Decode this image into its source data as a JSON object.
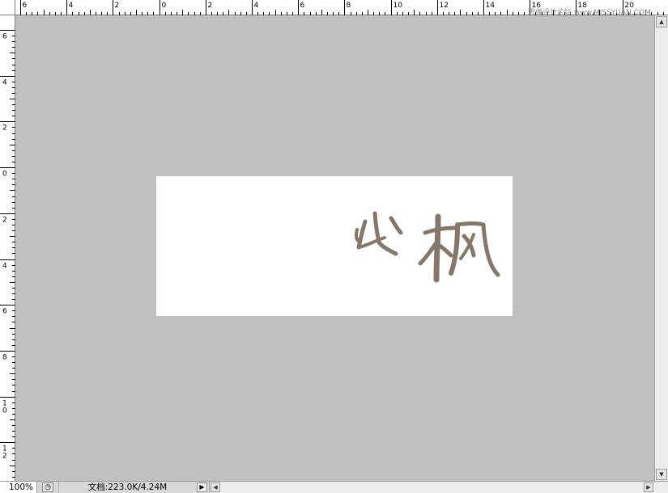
{
  "rulers": {
    "top_labels": [
      "6",
      "4",
      "2",
      "0",
      "2",
      "4",
      "6",
      "8",
      "10",
      "12",
      "14",
      "16",
      "18",
      "20"
    ],
    "left_labels": [
      "6",
      "4",
      "2",
      "0",
      "2",
      "4",
      "6",
      "8",
      "10",
      "12"
    ]
  },
  "document": {
    "calligraphy_text": "出枫",
    "ink_color": "#85786a",
    "canvas_color": "#c0c0c0"
  },
  "watermark": "思缘设计论坛 www.MISSYUAN.COM",
  "statusbar": {
    "zoom": "100%",
    "doc_info": "文档:223.0K/4.24M",
    "menu_arrow": "▶"
  },
  "icons": {
    "status_icon": "clock-icon",
    "scroll_left": "arrow-left-icon",
    "scroll_right": "arrow-right-icon",
    "scroll_up": "arrow-up-icon",
    "scroll_down": "arrow-down-icon"
  }
}
